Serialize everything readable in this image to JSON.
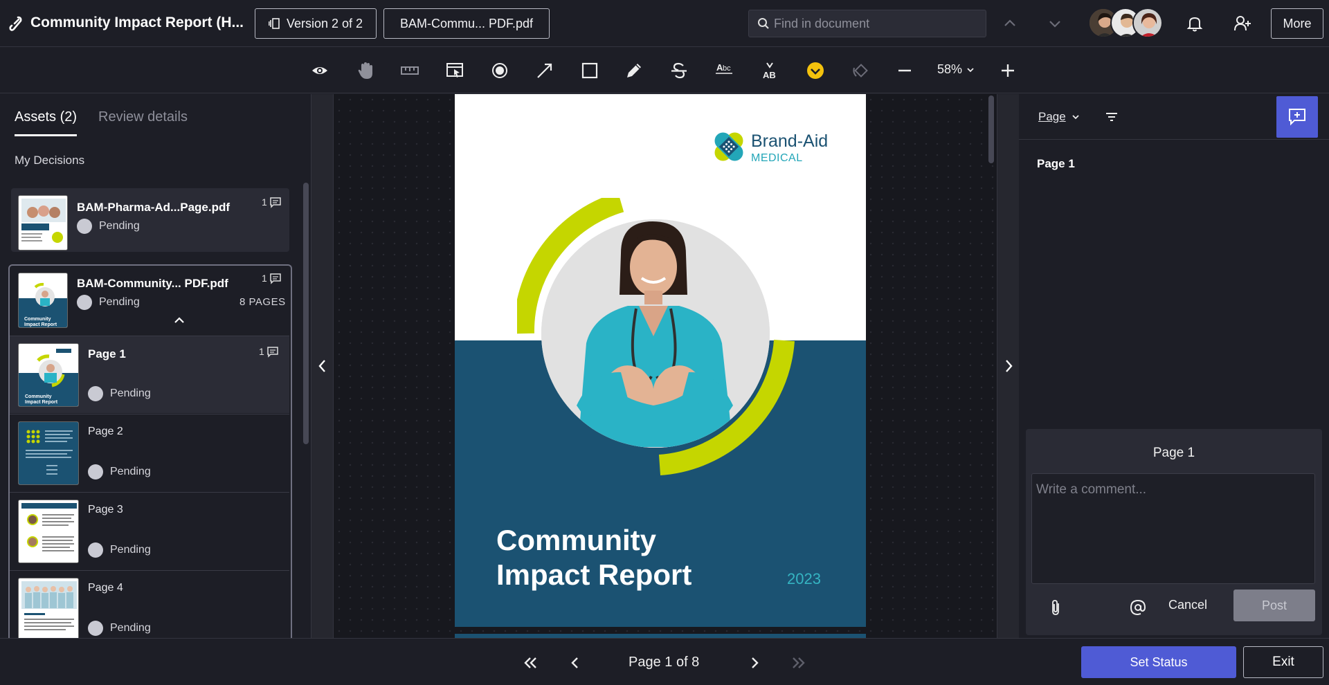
{
  "header": {
    "title": "Community Impact Report (H...",
    "version_label": "Version 2 of 2",
    "file_label": "BAM-Commu... PDF.pdf",
    "search_placeholder": "Find in document",
    "more_label": "More"
  },
  "toolbar": {
    "tools": [
      "eye-icon",
      "hand-icon",
      "ruler-icon",
      "select-area-icon",
      "record-icon",
      "arrow-icon",
      "rectangle-icon",
      "pencil-icon",
      "strikethrough-icon",
      "replace-text-icon",
      "insert-text-icon",
      "approve-check-icon",
      "rotate-icon",
      "zoom-out-icon",
      "zoom-in-icon"
    ],
    "zoom": "58%"
  },
  "left_panel": {
    "tabs": [
      "Assets (2)",
      "Review details"
    ],
    "section": "My Decisions",
    "assets": [
      {
        "name": "BAM-Pharma-Ad...Page.pdf",
        "status": "Pending",
        "comments": "1"
      },
      {
        "name": "BAM-Community... PDF.pdf",
        "status": "Pending",
        "comments": "1",
        "pages": "8 PAGES"
      }
    ],
    "pages": [
      {
        "label": "Page 1",
        "status": "Pending",
        "comments": "1"
      },
      {
        "label": "Page 2",
        "status": "Pending"
      },
      {
        "label": "Page 3",
        "status": "Pending"
      },
      {
        "label": "Page 4",
        "status": "Pending"
      }
    ]
  },
  "document": {
    "brand_name": "Brand-Aid",
    "brand_sub": "MEDICAL",
    "title_line1": "Community",
    "title_line2": "Impact Report",
    "year": "2023"
  },
  "right_panel": {
    "filter_label": "Page",
    "page_label": "Page 1",
    "comment_title": "Page 1",
    "comment_placeholder": "Write a comment...",
    "cancel_label": "Cancel",
    "post_label": "Post"
  },
  "footer": {
    "page_indicator": "Page 1 of 8",
    "set_status_label": "Set Status",
    "exit_label": "Exit"
  },
  "colors": {
    "accent": "#4f5bd5",
    "doc_blue": "#1b5272",
    "lime": "#c5d600",
    "teal": "#23a6b8"
  }
}
